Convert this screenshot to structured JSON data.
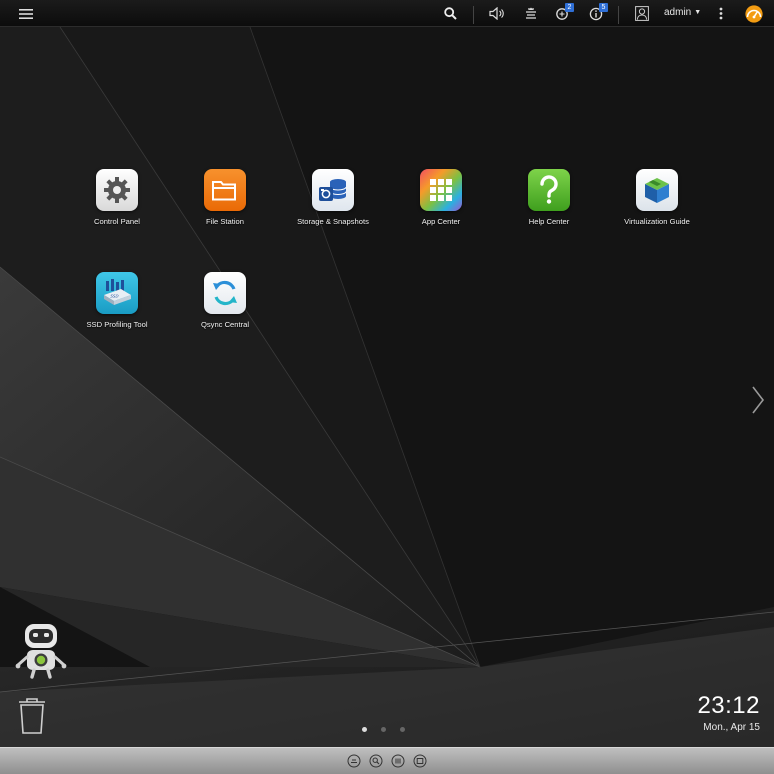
{
  "topbar": {
    "user": "admin",
    "notifications_count": "2",
    "info_count": "5"
  },
  "desktop": {
    "apps": [
      {
        "label": "Control Panel"
      },
      {
        "label": "File Station"
      },
      {
        "label": "Storage & Snapshots"
      },
      {
        "label": "App Center"
      },
      {
        "label": "Help Center"
      },
      {
        "label": "Virtualization Guide"
      },
      {
        "label": "SSD Profiling Tool"
      },
      {
        "label": "Qsync Central"
      }
    ],
    "clock": {
      "time": "23:12",
      "date": "Mon., Apr 15"
    }
  },
  "icons": {
    "menu": "hamburger-icon",
    "search": "search-icon",
    "volume": "speaker-icon",
    "tasks": "background-tasks-icon",
    "notifications": "event-notification-icon",
    "info": "info-icon",
    "user": "user-icon",
    "more": "more-vertical-icon",
    "dashboard": "dashboard-gauge-icon",
    "next": "chevron-right-icon",
    "trash": "trash-icon",
    "assistant": "robot-assistant-icon"
  },
  "colors": {
    "badge": "#2f6fd6",
    "dashboard": "#f39c12",
    "file_station": "#f07a12",
    "help_center": "#5cb82e"
  }
}
